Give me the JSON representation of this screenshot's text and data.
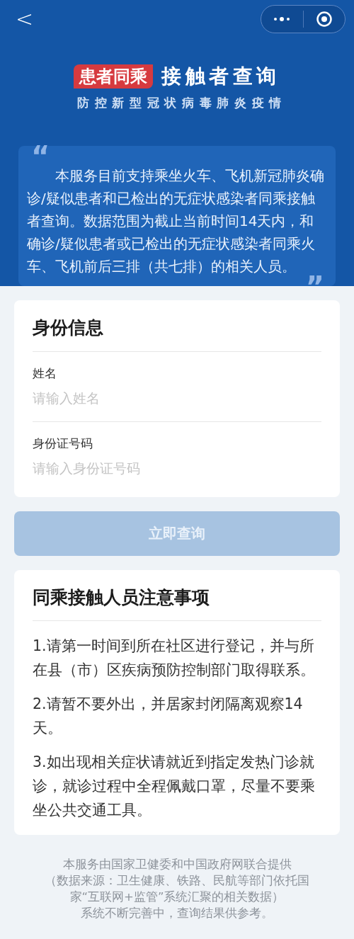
{
  "nav": {
    "back": "<"
  },
  "banner": {
    "badge": "患者同乘",
    "title": "接触者查询",
    "subtitle": "防控新型冠状病毒肺炎疫情"
  },
  "intro": {
    "open_quote": "“",
    "text": "本服务目前支持乘坐火车、飞机新冠肺炎确诊/疑似患者和已检出的无症状感染者同乘接触者查询。数据范围为截止当前时间14天内，和确诊/疑似患者或已检出的无症状感染者同乘火车、飞机前后三排（共七排）的相关人员。",
    "close_quote": "”"
  },
  "identity": {
    "title": "身份信息",
    "fields": [
      {
        "label": "姓名",
        "placeholder": "请输入姓名"
      },
      {
        "label": "身份证号码",
        "placeholder": "请输入身份证号码"
      }
    ]
  },
  "submit": {
    "label": "立即查询",
    "disabled": true
  },
  "notice": {
    "title": "同乘接触人员注意事项",
    "items": [
      "1.请第一时间到所在社区进行登记，并与所在县（市）区疾病预防控制部门取得联系。",
      "2.请暂不要外出，并居家封闭隔离观察14天。",
      "3.如出现相关症状请就近到指定发热门诊就诊，就诊过程中全程佩戴口罩，尽量不要乘坐公共交通工具。"
    ]
  },
  "footer": [
    "本服务由国家卫健委和中国政府网联合提供",
    "（数据来源：卫生健康、铁路、民航等部门依托国家“互联网+监管”系统汇聚的相关数据）",
    "系统不断完善中，查询结果供参考。"
  ]
}
